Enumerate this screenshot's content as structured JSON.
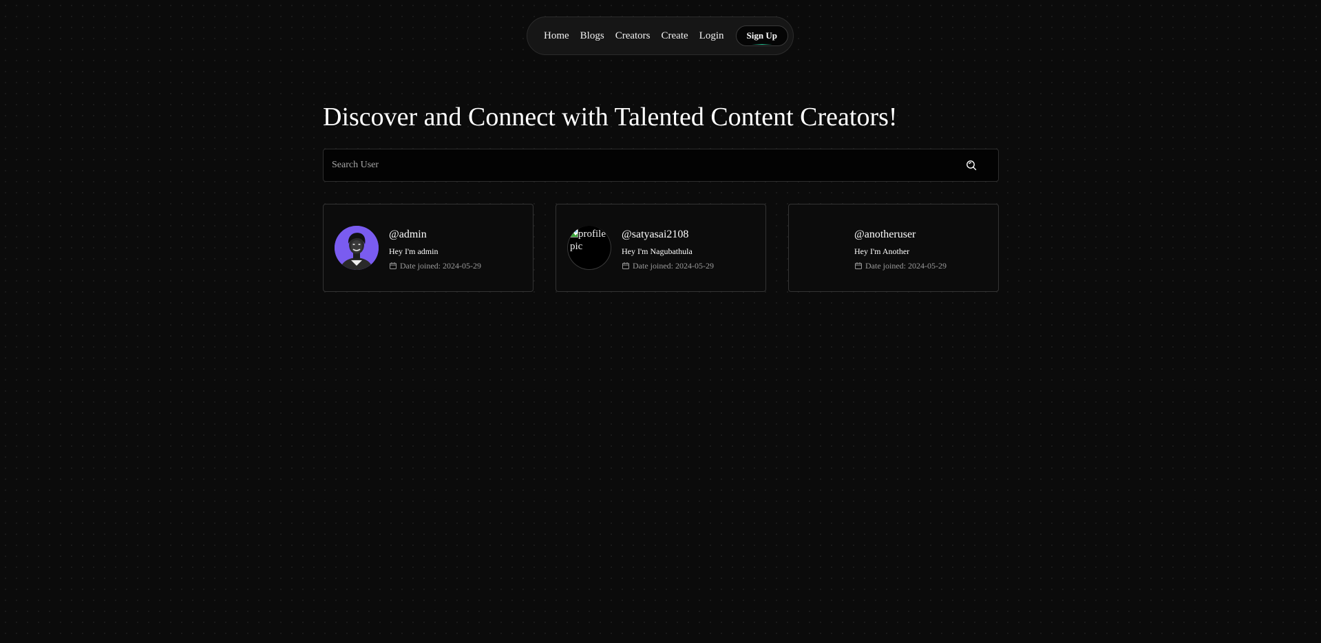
{
  "nav": {
    "links": [
      "Home",
      "Blogs",
      "Creators",
      "Create",
      "Login"
    ],
    "signup_label": "Sign Up"
  },
  "page": {
    "title": "Discover and Connect with Talented Content Creators!"
  },
  "search": {
    "placeholder": "Search User",
    "value": "",
    "icon": "search-icon"
  },
  "creators": [
    {
      "username": "@admin",
      "bio": "Hey I'm admin",
      "joined_label": "Date joined:",
      "joined_date": "2024-05-29",
      "avatar": "photo"
    },
    {
      "username": "@satyasai2108",
      "bio": "Hey I'm Nagubathula",
      "joined_label": "Date joined:",
      "joined_date": "2024-05-29",
      "avatar": "broken-image",
      "avatar_alt": "profile pic"
    },
    {
      "username": "@anotheruser",
      "bio": "Hey I'm Another",
      "joined_label": "Date joined:",
      "joined_date": "2024-05-29",
      "avatar": "none"
    }
  ],
  "colors": {
    "background": "#0b0b0b",
    "avatar_accent": "#7a5cf0",
    "signup_underline": "#2fd0a0"
  }
}
